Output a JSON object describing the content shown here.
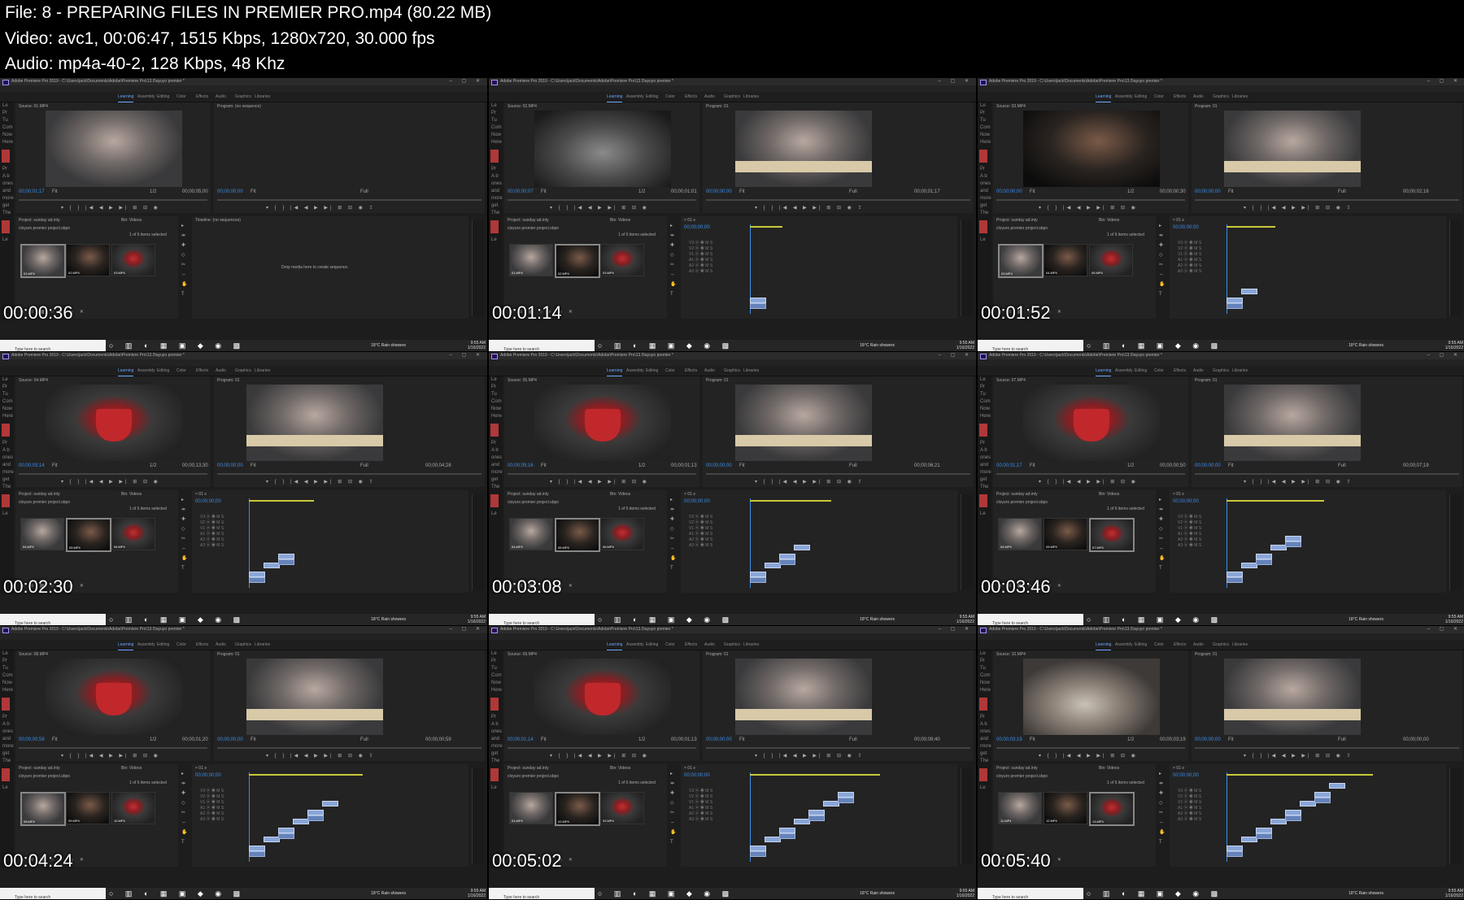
{
  "header": {
    "file_line": "File: 8 - PREPARING FILES IN PREMIER PRO.mp4 (80.22 MB)",
    "video_line": "Video: avc1, 00:06:47, 1515 Kbps, 1280x720, 30.000 fps",
    "audio_line": "Audio: mp4a-40-2, 128 Kbps, 48 Khz"
  },
  "common": {
    "app_title": "Adobe Premiere Pro 2019 - C:\\Users\\jack\\Documents\\Adobe\\Premiere Pro\\13.0\\ayuyo premier *",
    "menu": [
      "File",
      "Edit",
      "Clip",
      "Sequence",
      "Markers",
      "Graphics",
      "View",
      "Window",
      "Help"
    ],
    "workspaces": [
      "Learning",
      "Assembly",
      "Editing",
      "Color",
      "Effects",
      "Audio",
      "Graphics",
      "Libraries"
    ],
    "left_strip": [
      "Le",
      "Pr",
      "Tu",
      "Com",
      "Now",
      "Here",
      "Pr",
      "A b",
      "ones",
      "and",
      "more",
      "get",
      "The",
      "Le"
    ],
    "project_bin": "Project: sunday ad.inty",
    "project_path": "cloyuro premier project.sbpo",
    "bin_tab": "Bin: Videos",
    "items_selected": "1 of 6 items selected",
    "weather": "18°C Rain showers",
    "search_placeholder": "Type here to search",
    "clock_time": "9:55 AM",
    "clock_date": "1/16/2022",
    "timeline_label": "Timeline: (no sequences)",
    "drop_text": "Drop media here to create sequence.",
    "program_label": "Program: 01",
    "program_none": "Program: (no sequence)",
    "zero_tc": "00;00;00;00",
    "fit": "Fit",
    "half": "1/2",
    "full": "Full"
  },
  "frames": [
    {
      "timestamp": "00:00:36",
      "source": "Source: 01.MP4",
      "source_tc": "00;00;01;17",
      "source_dur": "00;00;05;00",
      "program_tc": "00;00;00;00",
      "program_dur": "",
      "thumbs": [
        "01.MP4",
        "02.MP4",
        "03.MP4"
      ],
      "selected": 0,
      "state": "empty"
    },
    {
      "timestamp": "00:01:14",
      "source": "Source: 02.MP4",
      "source_tc": "00;00;00;07",
      "source_dur": "00;00;01;01",
      "program_tc": "00;00;00;00",
      "program_dur": "00;00;01;17",
      "thumbs": [
        "01.MP4",
        "02.MP4",
        "03.MP4"
      ],
      "selected": 1,
      "state": "one"
    },
    {
      "timestamp": "00:01:52",
      "source": "Source: 03.MP4",
      "source_tc": "00;00;00;00",
      "source_dur": "00;00;00;30",
      "program_tc": "00;00;00;00",
      "program_dur": "00;00;02;16",
      "thumbs": [
        "03.MP4",
        "04.MP4",
        "05.MP4"
      ],
      "selected": 0,
      "state": "two"
    },
    {
      "timestamp": "00:02:30",
      "source": "Source: 04.MP4",
      "source_tc": "00;00;03;14",
      "source_dur": "00;00;13;30",
      "program_tc": "00;00;00;00",
      "program_dur": "00;00;04;28",
      "thumbs": [
        "04.MP4",
        "05.MP4",
        "06.MP4"
      ],
      "selected": 1,
      "state": "three"
    },
    {
      "timestamp": "00:03:08",
      "source": "Source: 05.MP4",
      "source_tc": "00;00;05;16",
      "source_dur": "00;00;01;13",
      "program_tc": "00;00;00;00",
      "program_dur": "00;00;06;21",
      "thumbs": [
        "04.MP4",
        "05.MP4",
        "06.MP4"
      ],
      "selected": 1,
      "state": "four"
    },
    {
      "timestamp": "00:03:46",
      "source": "Source: 07.MP4",
      "source_tc": "00;00;01;17",
      "source_dur": "00;00;00;50",
      "program_tc": "00;00;00;00",
      "program_dur": "00;00;07;19",
      "thumbs": [
        "04.MP4",
        "05.MP4",
        "07.MP4"
      ],
      "selected": 2,
      "state": "five"
    },
    {
      "timestamp": "00:04:24",
      "source": "Source: 08.MP4",
      "source_tc": "00;00;00;58",
      "source_dur": "00;00;01;20",
      "program_tc": "00;00;00;00",
      "program_dur": "00;00;00;59",
      "thumbs": [
        "08.MP4",
        "09.MP4",
        "10.MP4"
      ],
      "selected": 0,
      "state": "six"
    },
    {
      "timestamp": "00:05:02",
      "source": "Source: 09.MP4",
      "source_tc": "00;00;01;14",
      "source_dur": "00;00;01;13",
      "program_tc": "00;00;00;00",
      "program_dur": "00;00;09;40",
      "thumbs": [
        "01.MP4",
        "02.MP4",
        "03.MP4"
      ],
      "selected": 1,
      "state": "seven"
    },
    {
      "timestamp": "00:05:40",
      "source": "Source: 10.MP4",
      "source_tc": "00;00;03;19",
      "source_dur": "00;00;03;19",
      "program_tc": "00;00;00;00",
      "program_dur": "00;00;00;00",
      "thumbs": [
        "11.MP4",
        "12.MP4",
        "13.MP4"
      ],
      "selected": 2,
      "state": "eight"
    }
  ]
}
